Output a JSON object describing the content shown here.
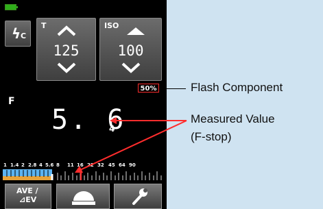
{
  "controls": {
    "mode_subscript": "C",
    "t_label": "T",
    "t_value": "125",
    "iso_label": "ISO",
    "iso_value": "100"
  },
  "flash_component_badge": "50%",
  "measurement": {
    "label": "F",
    "value": "5. 6",
    "subvalue": "4"
  },
  "scale_ticks": [
    "1",
    "1.4",
    "2",
    "2.8",
    "4",
    "5.6",
    "8",
    "11",
    "16",
    "22",
    "32",
    "45",
    "64",
    "90"
  ],
  "bottom_buttons": {
    "ave_line1": "AVE /",
    "ave_line2": "⊿EV"
  },
  "annotations": {
    "flash_component": "Flash Component",
    "measured_value_line1": "Measured Value",
    "measured_value_line2": "(F-stop)"
  },
  "colors": {
    "accent": "#ff2d2d",
    "battery": "#2fae1a",
    "background": "#cfe3f1"
  }
}
